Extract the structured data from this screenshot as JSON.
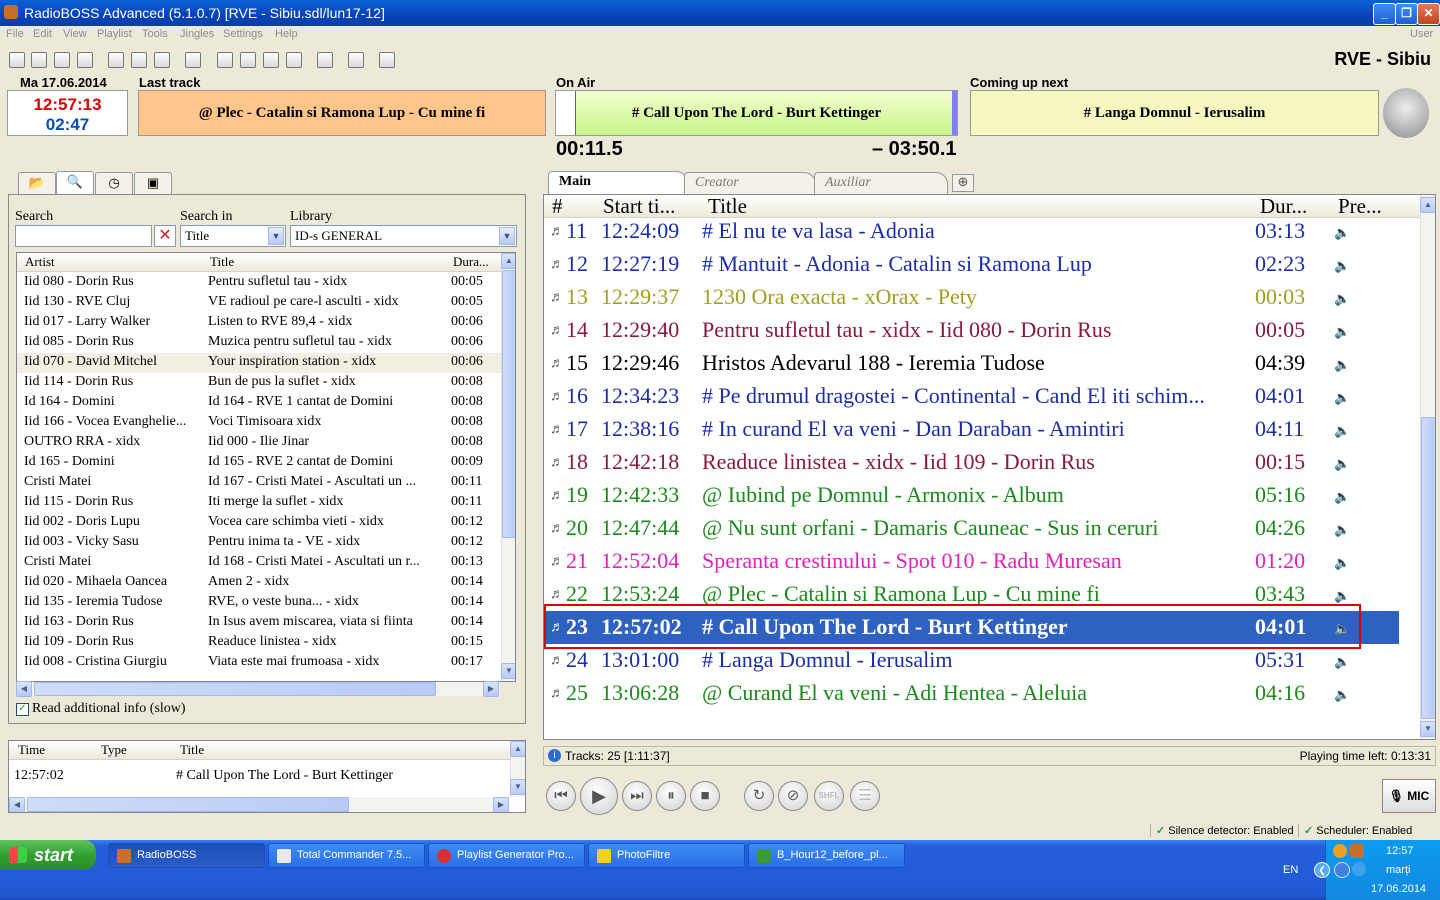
{
  "window": {
    "title": "RadioBOSS Advanced (5.1.0.7)   [RVE - Sibiu.sdl/lun17-12]"
  },
  "menu": [
    "File",
    "Edit",
    "View",
    "Playlist",
    "Tools",
    "Jingles",
    "Settings",
    "Help"
  ],
  "menu_user": "User",
  "station": "RVE - Sibiu",
  "clock": {
    "date": "Ma 17.06.2014",
    "time": "12:57:13",
    "sub_time": "02:47"
  },
  "labels": {
    "last_track": "Last track",
    "on_air": "On Air",
    "coming_up": "Coming up next"
  },
  "last_track": "@ Plec - Catalin si Ramona Lup - Cu mine fi",
  "on_air": {
    "title": "# Call Upon The Lord - Burt Kettinger",
    "elapsed": "00:11.5",
    "remaining": "– 03:50.1",
    "progress": 0.047
  },
  "coming_up": "# Langa Domnul - Ierusalim",
  "library": {
    "search_label": "Search",
    "search_value": "",
    "search_in_label": "Search in",
    "search_in_value": "Title",
    "library_label": "Library",
    "library_value": "ID-s GENERAL",
    "columns": [
      "Artist",
      "Title",
      "Dura..."
    ],
    "rows": [
      [
        "Iid 080 - Dorin Rus",
        "Pentru sufletul tau - xidx",
        "00:05"
      ],
      [
        "Iid 130 - RVE Cluj",
        "VE radioul pe care-l asculti - xidx",
        "00:05"
      ],
      [
        "Iid 017 - Larry Walker",
        "Listen to RVE 89,4 - xidx",
        "00:06"
      ],
      [
        "Iid 085 - Dorin Rus",
        "Muzica pentru sufletul tau - xidx",
        "00:06"
      ],
      [
        "Iid 070 - David Mitchel",
        "Your inspiration station - xidx",
        "00:06"
      ],
      [
        "Iid 114 - Dorin Rus",
        "Bun de pus la suflet - xidx",
        "00:08"
      ],
      [
        "Id 164 - Domini",
        "Id 164 - RVE 1 cantat de Domini",
        "00:08"
      ],
      [
        "Iid 166 - Vocea Evanghelie...",
        "Voci Timisoara xidx",
        "00:08"
      ],
      [
        "OUTRO RRA - xidx",
        "Iid 000 - Ilie Jinar",
        "00:08"
      ],
      [
        "Id 165 - Domini",
        "Id 165 - RVE 2 cantat de Domini",
        "00:09"
      ],
      [
        "Cristi Matei",
        "Id 167 - Cristi Matei -  Ascultati un ...",
        "00:11"
      ],
      [
        "Iid 115 - Dorin Rus",
        "Iti merge la suflet - xidx",
        "00:11"
      ],
      [
        "Iid 002 - Doris Lupu",
        "Vocea care schimba vieti - xidx",
        "00:12"
      ],
      [
        "Iid 003 - Vicky Sasu",
        "Pentru inima ta - VE - xidx",
        "00:12"
      ],
      [
        "Cristi Matei",
        "Id 168 - Cristi Matei - Ascultati un r...",
        "00:13"
      ],
      [
        "Iid 020 - Mihaela Oancea",
        "Amen 2 - xidx",
        "00:14"
      ],
      [
        "Iid 135 - Ieremia Tudose",
        "RVE, o veste buna... - xidx",
        "00:14"
      ],
      [
        "Iid 163 - Dorin Rus",
        "In Isus avem miscarea, viata si fiinta",
        "00:14"
      ],
      [
        "Iid 109 - Dorin Rus",
        "Readuce linistea - xidx",
        "00:15"
      ],
      [
        "Iid 008 - Cristina Giurgiu",
        "Viata este mai frumoasa - xidx",
        "00:17"
      ]
    ],
    "selected_row": 4,
    "read_info_label": "Read additional info (slow)"
  },
  "history": {
    "columns": [
      "Time",
      "Type",
      "Title"
    ],
    "rows": [
      [
        "12:57:02",
        "",
        "# Call Upon The Lord - Burt Kettinger"
      ]
    ]
  },
  "tabs": [
    "Main",
    "Creator",
    "Auxiliar"
  ],
  "playlist": {
    "columns": [
      "#",
      "Start ti...",
      "Title",
      "Dur...",
      "Pre..."
    ],
    "rows": [
      {
        "n": "11",
        "start": "12:24:09",
        "title": "# El nu te va lasa - Adonia",
        "dur": "03:13",
        "color": "#1a2ea8"
      },
      {
        "n": "12",
        "start": "12:27:19",
        "title": "# Mantuit - Adonia - Catalin si Ramona Lup",
        "dur": "02:23",
        "color": "#1a2ea8"
      },
      {
        "n": "13",
        "start": "12:29:37",
        "title": "1230 Ora exacta - xOrax - Pety",
        "dur": "00:03",
        "color": "#a0a020"
      },
      {
        "n": "14",
        "start": "12:29:40",
        "title": "Pentru sufletul tau - xidx - Iid 080 - Dorin Rus",
        "dur": "00:05",
        "color": "#8a1a3a"
      },
      {
        "n": "15",
        "start": "12:29:46",
        "title": "Hristos Adevarul 188 - Ieremia Tudose",
        "dur": "04:39",
        "color": "#000000"
      },
      {
        "n": "16",
        "start": "12:34:23",
        "title": "# Pe drumul dragostei - Continental - Cand El iti schim...",
        "dur": "04:01",
        "color": "#1a2ea8"
      },
      {
        "n": "17",
        "start": "12:38:16",
        "title": "# In curand El va veni - Dan Daraban - Amintiri",
        "dur": "04:11",
        "color": "#1a2ea8"
      },
      {
        "n": "18",
        "start": "12:42:18",
        "title": "Readuce linistea - xidx - Iid 109 - Dorin Rus",
        "dur": "00:15",
        "color": "#8a1a3a"
      },
      {
        "n": "19",
        "start": "12:42:33",
        "title": "@ Iubind pe Domnul - Armonix - Album",
        "dur": "05:16",
        "color": "#1a8a1a"
      },
      {
        "n": "20",
        "start": "12:47:44",
        "title": "@ Nu sunt orfani - Damaris Cauneac - Sus in ceruri",
        "dur": "04:26",
        "color": "#1a8a1a"
      },
      {
        "n": "21",
        "start": "12:52:04",
        "title": "Speranta crestinului - Spot 010 - Radu Muresan",
        "dur": "01:20",
        "color": "#e020c0"
      },
      {
        "n": "22",
        "start": "12:53:24",
        "title": "@ Plec - Catalin si Ramona Lup - Cu mine fi",
        "dur": "03:43",
        "color": "#1a8a1a"
      },
      {
        "n": "23",
        "start": "12:57:02",
        "title": "# Call Upon The Lord - Burt Kettinger",
        "dur": "04:01",
        "color": "#ffffff"
      },
      {
        "n": "24",
        "start": "13:01:00",
        "title": "# Langa Domnul - Ierusalim",
        "dur": "05:31",
        "color": "#1a2ea8"
      },
      {
        "n": "25",
        "start": "13:06:28",
        "title": "@ Curand El va veni - Adi Hentea - Aleluia",
        "dur": "04:16",
        "color": "#1a8a1a"
      }
    ],
    "current_index": 12,
    "tracks_info": "Tracks: 25 [1:11:37]",
    "time_left": "Playing time left: 0:13:31"
  },
  "controls": {
    "shfl": "SHFL",
    "mic": "MIC"
  },
  "status": {
    "silence": "Silence detector: Enabled",
    "scheduler": "Scheduler: Enabled"
  },
  "taskbar": {
    "start": "start",
    "items": [
      "RadioBOSS",
      "Total Commander 7.5...",
      "Playlist Generator Pro...",
      "PhotoFiltre",
      "B_Hour12_before_pl..."
    ],
    "lang": "EN",
    "time": "12:57",
    "day": "marți",
    "date": "17.06.2014"
  },
  "colors": {
    "titlebar": "#0a5fd8",
    "current_row": "#2f62c0",
    "highlight_frame": "#e00000",
    "last_track_bg": "#ffc68c",
    "on_air_bg": "#c8f58a"
  }
}
